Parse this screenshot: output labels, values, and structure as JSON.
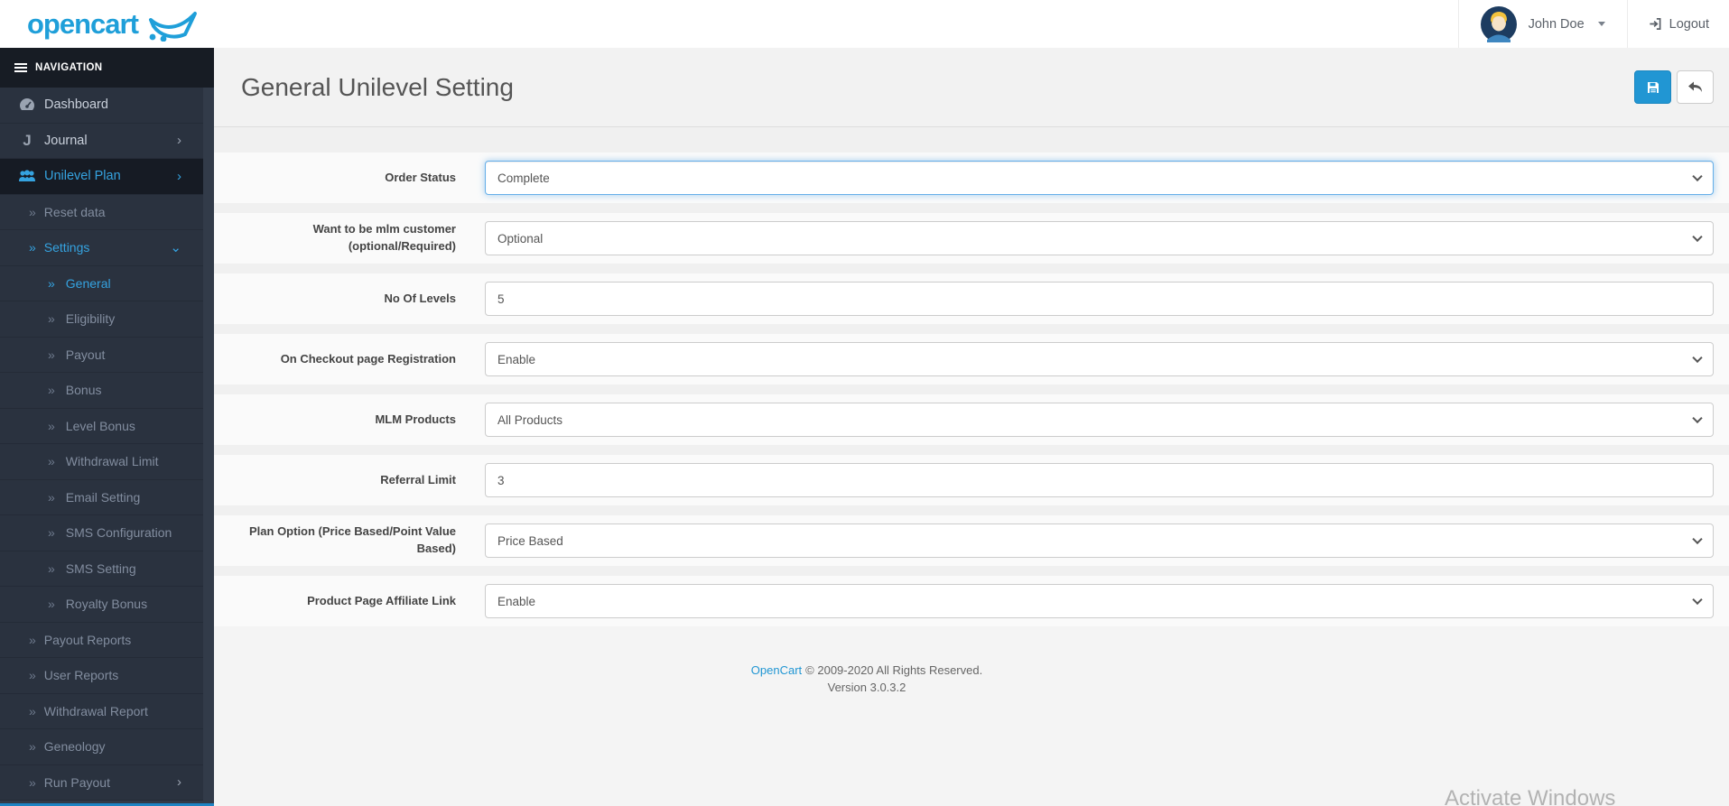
{
  "header": {
    "logo": "opencart",
    "user_name": "John Doe",
    "logout_label": "Logout"
  },
  "page": {
    "title": "General Unilevel Setting"
  },
  "sidebar": {
    "nav_label": "NAVIGATION",
    "items": [
      {
        "label": "Dashboard"
      },
      {
        "label": "Journal"
      },
      {
        "label": "Unilevel Plan"
      },
      {
        "label": "Reset data"
      },
      {
        "label": "Settings"
      },
      {
        "label": "General"
      },
      {
        "label": "Eligibility"
      },
      {
        "label": "Payout"
      },
      {
        "label": "Bonus"
      },
      {
        "label": "Level Bonus"
      },
      {
        "label": "Withdrawal Limit"
      },
      {
        "label": "Email Setting"
      },
      {
        "label": "SMS Configuration"
      },
      {
        "label": "SMS Setting"
      },
      {
        "label": "Royalty Bonus"
      },
      {
        "label": "Payout Reports"
      },
      {
        "label": "User Reports"
      },
      {
        "label": "Withdrawal Report"
      },
      {
        "label": "Geneology"
      },
      {
        "label": "Run Payout"
      }
    ]
  },
  "form": {
    "rows": [
      {
        "label": "Order Status",
        "value": "Complete"
      },
      {
        "label": "Want to be mlm customer (optional/Required)",
        "value": "Optional"
      },
      {
        "label": "No Of Levels",
        "value": "5"
      },
      {
        "label": "On Checkout page Registration",
        "value": "Enable"
      },
      {
        "label": "MLM Products",
        "value": "All Products"
      },
      {
        "label": "Referral Limit",
        "value": "3"
      },
      {
        "label": "Plan Option (Price Based/Point Value Based)",
        "value": "Price Based"
      },
      {
        "label": "Product Page Affiliate Link",
        "value": "Enable"
      }
    ]
  },
  "footer": {
    "brand": "OpenCart",
    "copyright": "© 2009-2020 All Rights Reserved.",
    "version": "Version 3.0.3.2"
  },
  "watermark": {
    "text": "Activate Windows"
  },
  "colors": {
    "accent": "#2196d3",
    "sidebar_bg": "#323b49",
    "sidebar_active_text": "#35a3e0",
    "focus_border": "#66afe9"
  }
}
